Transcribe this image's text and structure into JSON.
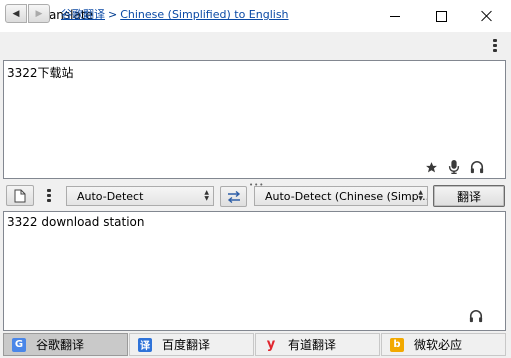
{
  "window": {
    "title": "QTranslate"
  },
  "breadcrumb": {
    "service": "谷歌翻译",
    "separator": ">",
    "direction": "Chinese (Simplified) to English"
  },
  "source": {
    "text": "3322下载站"
  },
  "toolbar": {
    "source_language": "Auto-Detect",
    "target_language": "Auto-Detect (Chinese (Simp...",
    "translate_label": "翻译"
  },
  "result": {
    "text": "3322 download station"
  },
  "tabs": [
    {
      "label": "谷歌翻译",
      "logo": "G",
      "active": true
    },
    {
      "label": "百度翻译",
      "logo": "译",
      "active": false
    },
    {
      "label": "有道翻译",
      "logo": "y",
      "active": false
    },
    {
      "label": "微软必应",
      "logo": "b",
      "active": false
    }
  ],
  "colors": {
    "link": "#0a49a5",
    "google": "#4a86e8",
    "baidu": "#2f73d9",
    "youdao": "#e0262e",
    "bing": "#f2a900"
  }
}
